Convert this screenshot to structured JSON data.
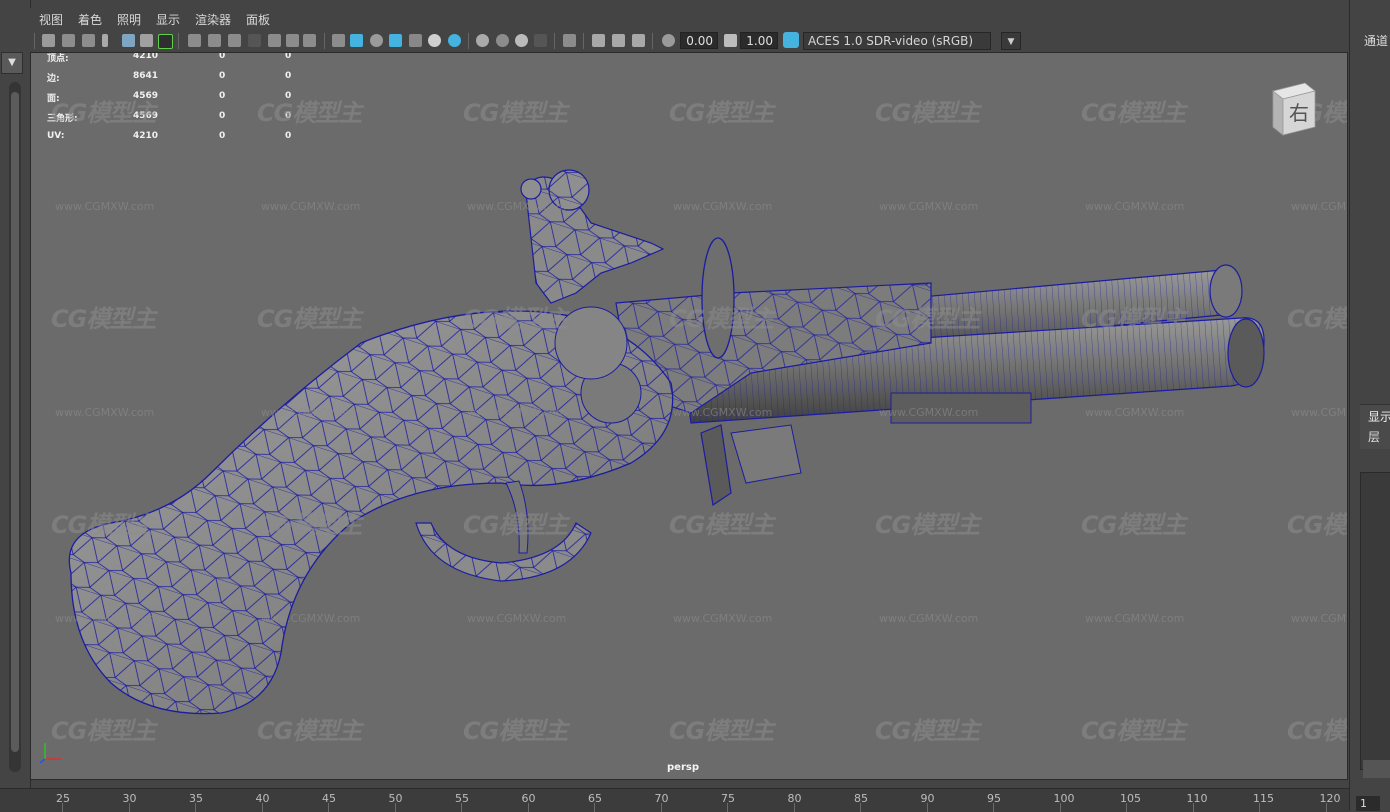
{
  "menu": [
    "视图",
    "着色",
    "照明",
    "显示",
    "渲染器",
    "面板"
  ],
  "toolbar": {
    "field1": "0.00",
    "field2": "1.00",
    "color_space": "ACES 1.0 SDR-video (sRGB)"
  },
  "hud": {
    "rows": [
      {
        "label": "顶点:",
        "v1": "4210",
        "v2": "0",
        "v3": "0"
      },
      {
        "label": "边:",
        "v1": "8641",
        "v2": "0",
        "v3": "0"
      },
      {
        "label": "面:",
        "v1": "4569",
        "v2": "0",
        "v3": "0"
      },
      {
        "label": "三角形:",
        "v1": "4569",
        "v2": "0",
        "v3": "0"
      },
      {
        "label": "UV:",
        "v1": "4210",
        "v2": "0",
        "v3": "0"
      }
    ]
  },
  "viewport": {
    "camera": "persp",
    "viewcube_face": "右"
  },
  "watermark": {
    "logo": "CG模型主",
    "url": "www.CGMXW.com"
  },
  "right_panel": {
    "channels": "通道",
    "display": "显示",
    "layer": "层",
    "frame": "1"
  },
  "timeline": {
    "ticks": [
      "25",
      "30",
      "35",
      "40",
      "45",
      "50",
      "55",
      "60",
      "65",
      "70",
      "75",
      "80",
      "85",
      "90",
      "95",
      "100",
      "105",
      "110",
      "115",
      "120"
    ]
  },
  "colors": {
    "viewport_bg": "#6b6b6b",
    "wire": "#1c1ca0",
    "ui_bg": "#444444",
    "accent": "#44b3e0"
  }
}
